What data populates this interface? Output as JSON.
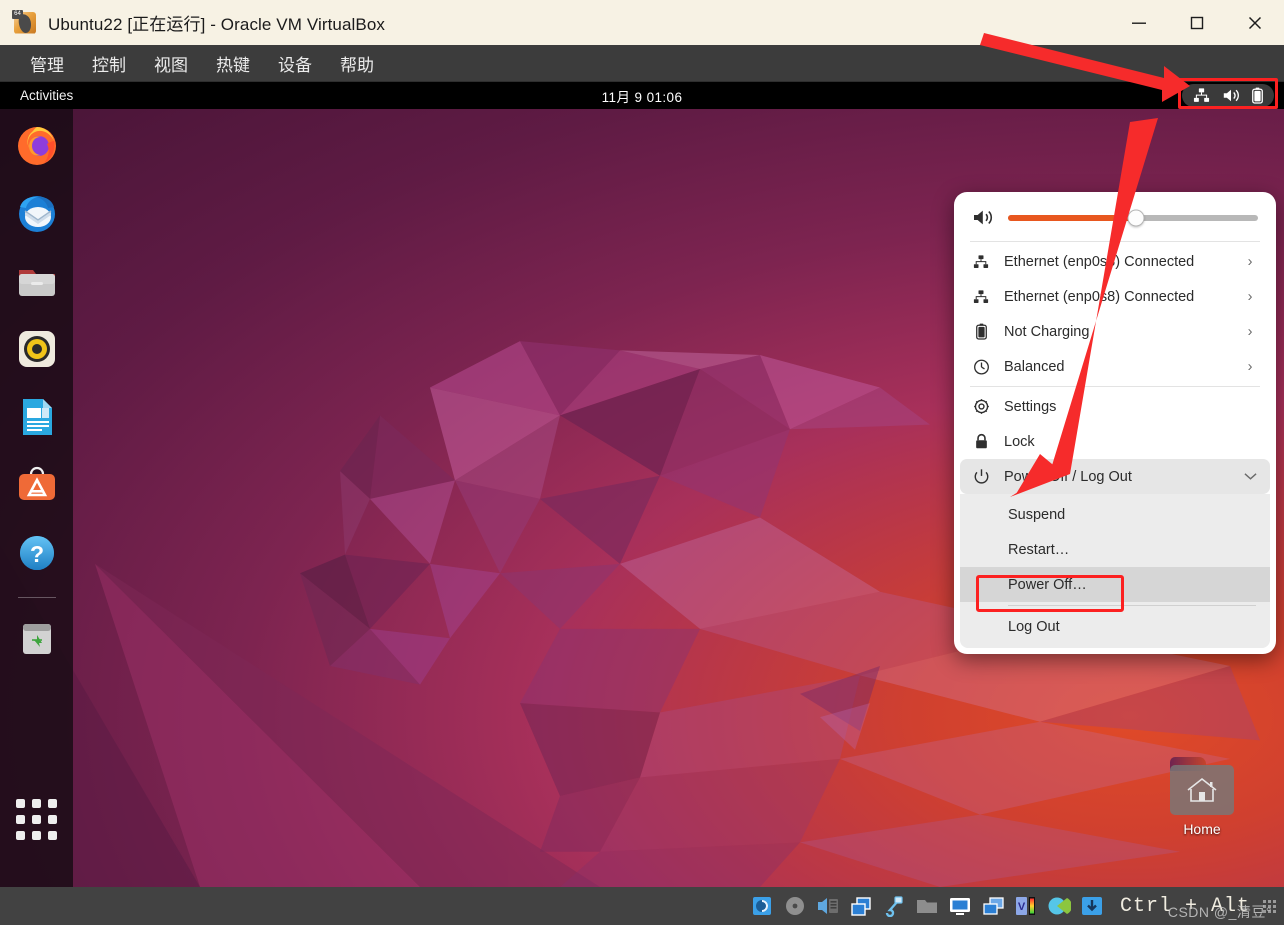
{
  "window": {
    "title": "Ubuntu22 [正在运行] - Oracle VM VirtualBox",
    "logo_badge": "64",
    "controls": [
      {
        "name": "minimize",
        "label": "—"
      },
      {
        "name": "maximize",
        "label": "□"
      },
      {
        "name": "close",
        "label": "✕"
      }
    ]
  },
  "vbox_menu": {
    "items": [
      {
        "label": "管理"
      },
      {
        "label": "控制"
      },
      {
        "label": "视图"
      },
      {
        "label": "热键"
      },
      {
        "label": "设备"
      },
      {
        "label": "帮助"
      }
    ]
  },
  "gnome_topbar": {
    "activities": "Activities",
    "clock": "11月 9  01:06",
    "tray_icons": [
      {
        "name": "network-wired-icon"
      },
      {
        "name": "volume-icon"
      },
      {
        "name": "battery-icon"
      }
    ]
  },
  "dock": {
    "items": [
      {
        "name": "firefox",
        "label": "Firefox"
      },
      {
        "name": "thunderbird",
        "label": "Thunderbird Mail"
      },
      {
        "name": "files",
        "label": "Files"
      },
      {
        "name": "rhythmbox",
        "label": "Rhythmbox"
      },
      {
        "name": "libreoffice-writer",
        "label": "LibreOffice Writer"
      },
      {
        "name": "ubuntu-software",
        "label": "Ubuntu Software"
      },
      {
        "name": "help",
        "label": "Help"
      },
      {
        "name": "trash",
        "label": "Trash"
      }
    ],
    "apps_button": "Show Applications"
  },
  "desktop": {
    "home_icon_label": "Home"
  },
  "system_menu": {
    "volume": {
      "icon": "volume-high-icon",
      "value": 51
    },
    "rows": [
      {
        "icon": "network-wired-icon",
        "label": "Ethernet (enp0s3) Connected",
        "chevron": "›"
      },
      {
        "icon": "network-wired-icon",
        "label": "Ethernet (enp0s8) Connected",
        "chevron": "›"
      },
      {
        "icon": "battery-icon",
        "label": "Not Charging",
        "chevron": "›"
      },
      {
        "icon": "power-profile-icon",
        "label": "Balanced",
        "chevron": "›"
      }
    ],
    "actions": [
      {
        "icon": "gear-icon",
        "label": "Settings"
      },
      {
        "icon": "lock-icon",
        "label": "Lock"
      }
    ],
    "power": {
      "icon": "power-icon",
      "label": "Power Off / Log Out",
      "chevron": "⌄",
      "submenu": [
        {
          "label": "Suspend",
          "selected": false
        },
        {
          "label": "Restart…",
          "selected": false
        },
        {
          "label": "Power Off…",
          "selected": true
        },
        {
          "label": "Log Out",
          "selected": false,
          "after_divider": true
        }
      ]
    }
  },
  "statusbar": {
    "icons": [
      {
        "name": "hard-disk-icon"
      },
      {
        "name": "optical-disk-icon"
      },
      {
        "name": "audio-icon"
      },
      {
        "name": "network-adapter-icon"
      },
      {
        "name": "usb-icon"
      },
      {
        "name": "shared-folder-icon"
      },
      {
        "name": "display-icon"
      },
      {
        "name": "recording-icon"
      },
      {
        "name": "vrde-icon"
      },
      {
        "name": "guest-additions-icon"
      },
      {
        "name": "mouse-integration-icon"
      }
    ],
    "host_key": "Ctrl + Alt",
    "watermark": "CSDN @_清豆°"
  },
  "colors": {
    "accent_orange": "#e8571f",
    "annotation_red": "#fc2121",
    "titlebar_bg": "#f7f2e4",
    "vbox_chrome": "#3c3c3c",
    "menu_bg": "#ffffff"
  }
}
